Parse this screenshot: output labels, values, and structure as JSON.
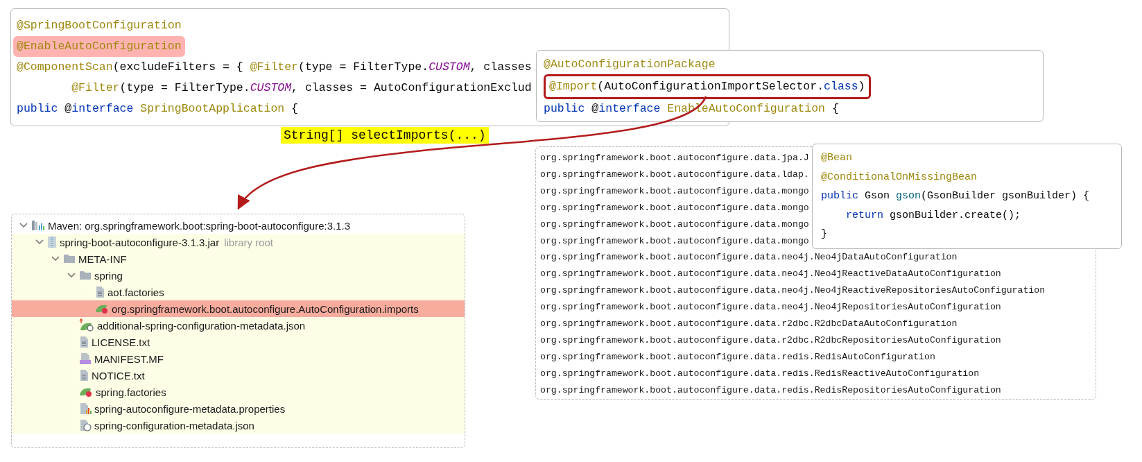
{
  "annotation_panel": {
    "lines": [
      {
        "highlighted": false,
        "tokens": [
          {
            "text": "@SpringBootConfiguration",
            "kind": "annotation"
          }
        ]
      },
      {
        "highlighted": true,
        "tokens": [
          {
            "text": "@EnableAutoConfiguration",
            "kind": "annotation"
          }
        ]
      },
      {
        "highlighted": false,
        "tokens": [
          {
            "text": "@ComponentScan",
            "kind": "annotation"
          },
          {
            "text": "(excludeFilters = { ",
            "kind": "plain"
          },
          {
            "text": "@Filter",
            "kind": "annotation"
          },
          {
            "text": "(type = FilterType.",
            "kind": "plain"
          },
          {
            "text": "CUSTOM",
            "kind": "constant"
          },
          {
            "text": ", classes",
            "kind": "plain"
          }
        ]
      },
      {
        "highlighted": false,
        "tokens": [
          {
            "text": "        @Filter",
            "kind": "annotation"
          },
          {
            "text": "(type = FilterType.",
            "kind": "plain"
          },
          {
            "text": "CUSTOM",
            "kind": "constant"
          },
          {
            "text": ", classes = AutoConfigurationExclud",
            "kind": "plain"
          }
        ]
      },
      {
        "highlighted": false,
        "tokens": [
          {
            "text": "public",
            "kind": "keyword"
          },
          {
            "text": " @",
            "kind": "plain"
          },
          {
            "text": "interface",
            "kind": "keyword"
          },
          {
            "text": " SpringBootApplication",
            "kind": "annotation"
          },
          {
            "text": " {",
            "kind": "plain"
          }
        ]
      }
    ]
  },
  "enable_panel": {
    "lines": [
      {
        "boxed": false,
        "tokens": [
          {
            "text": "@AutoConfigurationPackage",
            "kind": "annotation"
          }
        ]
      },
      {
        "boxed": true,
        "tokens": [
          {
            "text": "@Import",
            "kind": "annotation"
          },
          {
            "text": "(AutoConfigurationImportSelector.",
            "kind": "plain"
          },
          {
            "text": "class",
            "kind": "keyword"
          },
          {
            "text": ")",
            "kind": "plain"
          }
        ]
      },
      {
        "boxed": false,
        "tokens": [
          {
            "text": "public",
            "kind": "keyword"
          },
          {
            "text": " @",
            "kind": "plain"
          },
          {
            "text": "interface",
            "kind": "keyword"
          },
          {
            "text": " EnableAutoConfiguration",
            "kind": "annotation"
          },
          {
            "text": " {",
            "kind": "plain"
          }
        ]
      }
    ]
  },
  "method_label": "String[] selectImports(...)",
  "tree": {
    "items": [
      {
        "label": "Maven: org.springframework.boot:spring-boot-autoconfigure:3.1.3",
        "kind": "maven",
        "expanded": true,
        "selected": false,
        "children": [
          {
            "label": "spring-boot-autoconfigure-3.1.3.jar",
            "note": "library root",
            "kind": "jar",
            "expanded": true,
            "selected": false,
            "children": [
              {
                "label": "META-INF",
                "kind": "folder",
                "expanded": true,
                "selected": false,
                "children": [
                  {
                    "label": "spring",
                    "kind": "folder",
                    "expanded": true,
                    "selected": false,
                    "children": [
                      {
                        "label": "aot.factories",
                        "kind": "file",
                        "selected": false
                      },
                      {
                        "label": "org.springframework.boot.autoconfigure.AutoConfiguration.imports",
                        "kind": "spring",
                        "selected": true
                      }
                    ]
                  },
                  {
                    "label": "additional-spring-configuration-metadata.json",
                    "kind": "spring-json",
                    "selected": false
                  },
                  {
                    "label": "LICENSE.txt",
                    "kind": "file",
                    "selected": false
                  },
                  {
                    "label": "MANIFEST.MF",
                    "kind": "manifest",
                    "selected": false
                  },
                  {
                    "label": "NOTICE.txt",
                    "kind": "file",
                    "selected": false
                  },
                  {
                    "label": "spring.factories",
                    "kind": "spring",
                    "selected": false
                  },
                  {
                    "label": "spring-autoconfigure-metadata.properties",
                    "kind": "properties",
                    "selected": false
                  },
                  {
                    "label": "spring-configuration-metadata.json",
                    "kind": "json",
                    "selected": false
                  }
                ]
              }
            ]
          }
        ]
      }
    ]
  },
  "imports_list": [
    "org.springframework.boot.autoconfigure.data.jpa.J",
    "org.springframework.boot.autoconfigure.data.ldap.",
    "org.springframework.boot.autoconfigure.data.mongo",
    "org.springframework.boot.autoconfigure.data.mongo",
    "org.springframework.boot.autoconfigure.data.mongo",
    "org.springframework.boot.autoconfigure.data.mongo",
    "org.springframework.boot.autoconfigure.data.neo4j.Neo4jDataAutoConfiguration",
    "org.springframework.boot.autoconfigure.data.neo4j.Neo4jReactiveDataAutoConfiguration",
    "org.springframework.boot.autoconfigure.data.neo4j.Neo4jReactiveRepositoriesAutoConfiguration",
    "org.springframework.boot.autoconfigure.data.neo4j.Neo4jRepositoriesAutoConfiguration",
    "org.springframework.boot.autoconfigure.data.r2dbc.R2dbcDataAutoConfiguration",
    "org.springframework.boot.autoconfigure.data.r2dbc.R2dbcRepositoriesAutoConfiguration",
    "org.springframework.boot.autoconfigure.data.redis.RedisAutoConfiguration",
    "org.springframework.boot.autoconfigure.data.redis.RedisReactiveAutoConfiguration",
    "org.springframework.boot.autoconfigure.data.redis.RedisRepositoriesAutoConfiguration"
  ],
  "bean_panel": {
    "lines": [
      {
        "tokens": [
          {
            "text": "@Bean",
            "kind": "annotation"
          }
        ]
      },
      {
        "tokens": [
          {
            "text": "@ConditionalOnMissingBean",
            "kind": "annotation"
          }
        ]
      },
      {
        "tokens": [
          {
            "text": "public",
            "kind": "keyword"
          },
          {
            "text": " Gson ",
            "kind": "plain"
          },
          {
            "text": "gson",
            "kind": "method"
          },
          {
            "text": "(GsonBuilder gsonBuilder) {",
            "kind": "plain"
          }
        ]
      },
      {
        "tokens": [
          {
            "text": "    return",
            "kind": "keyword"
          },
          {
            "text": " gsonBuilder.create();",
            "kind": "plain"
          }
        ]
      },
      {
        "tokens": [
          {
            "text": "}",
            "kind": "plain"
          }
        ]
      }
    ]
  }
}
